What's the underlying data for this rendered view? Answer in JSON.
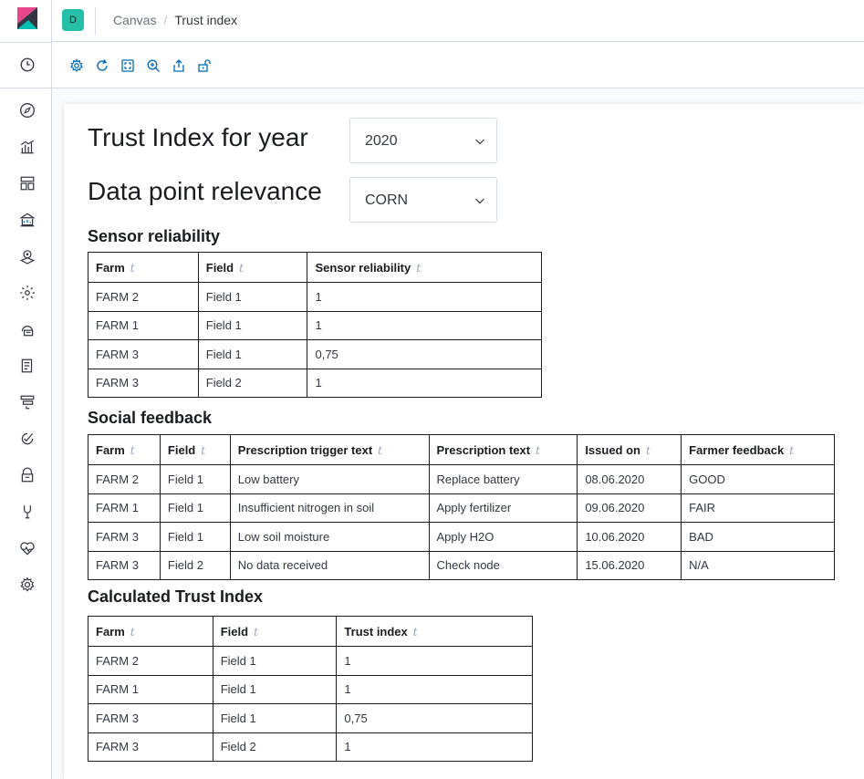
{
  "header": {
    "space_initial": "D",
    "breadcrumbs": [
      "Canvas",
      "Trust index"
    ],
    "separator": "/"
  },
  "colors": {
    "accent": "#006bb4",
    "space_badge": "#26c0a8",
    "border": "#d3dae6"
  },
  "nav_icons": [
    "clock-icon",
    "compass-icon",
    "visualize-icon",
    "dashboard-icon",
    "canvas-icon",
    "maps-icon",
    "ml-icon",
    "infrastructure-icon",
    "logs-icon",
    "apm-icon",
    "uptime-icon",
    "siem-icon",
    "dev-tools-icon",
    "monitoring-icon",
    "management-icon"
  ],
  "toolbar_icons": [
    "settings-icon",
    "refresh-icon",
    "fullscreen-icon",
    "zoom-icon",
    "share-icon",
    "lock-icon"
  ],
  "workpad": {
    "year_label": "Trust Index for year",
    "year_value": "2020",
    "relevance_label": "Data point relevance",
    "relevance_value": "CORN",
    "sort_glyph": "t",
    "sensor": {
      "title": "Sensor reliability",
      "columns": [
        "Farm",
        "Field",
        "Sensor reliability"
      ],
      "rows": [
        [
          "FARM 2",
          "Field 1",
          "1"
        ],
        [
          "FARM 1",
          "Field 1",
          "1"
        ],
        [
          "FARM 3",
          "Field 1",
          "0,75"
        ],
        [
          "FARM 3",
          "Field 2",
          "1"
        ]
      ]
    },
    "social": {
      "title": "Social feedback",
      "columns": [
        "Farm",
        "Field",
        "Prescription trigger text",
        "Prescription text",
        "Issued on",
        "Farmer feedback"
      ],
      "rows": [
        [
          "FARM 2",
          "Field 1",
          "Low battery",
          "Replace battery",
          "08.06.2020",
          "GOOD"
        ],
        [
          "FARM 1",
          "Field 1",
          "Insufficient nitrogen in soil",
          "Apply fertilizer",
          "09.06.2020",
          "FAIR"
        ],
        [
          "FARM 3",
          "Field 1",
          "Low soil moisture",
          "Apply H2O",
          "10.06.2020",
          "BAD"
        ],
        [
          "FARM 3",
          "Field 2",
          "No data received",
          "Check node",
          "15.06.2020",
          "N/A"
        ]
      ]
    },
    "trust": {
      "title": "Calculated Trust Index",
      "columns": [
        "Farm",
        "Field",
        "Trust index"
      ],
      "rows": [
        [
          "FARM 2",
          "Field 1",
          "1"
        ],
        [
          "FARM 1",
          "Field 1",
          "1"
        ],
        [
          "FARM 3",
          "Field 1",
          "0,75"
        ],
        [
          "FARM 3",
          "Field 2",
          "1"
        ]
      ]
    }
  }
}
